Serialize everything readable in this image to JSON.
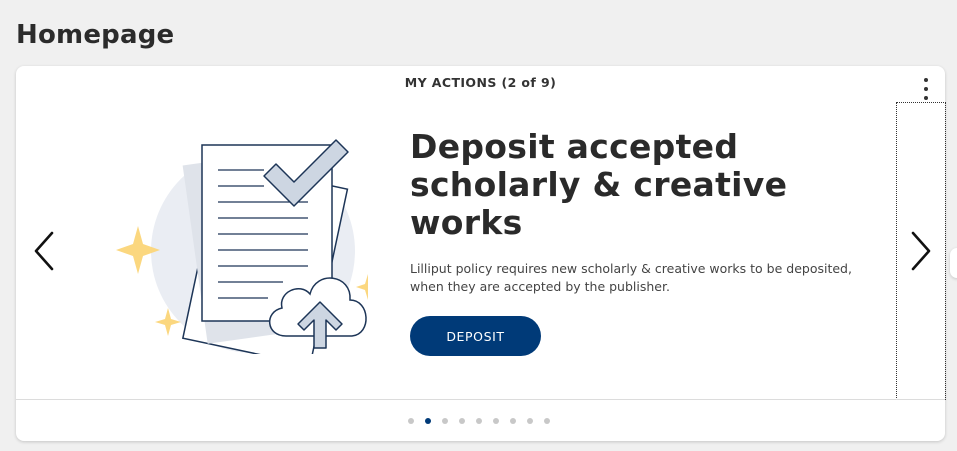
{
  "page": {
    "title": "Homepage"
  },
  "card": {
    "header": "MY ACTIONS (2 of 9)",
    "headline": "Deposit accepted scholarly & creative works",
    "description": "Lilliput policy requires new scholarly & creative works to be deposited, when they are accepted by the publisher.",
    "button_label": "DEPOSIT",
    "current_slide": 2,
    "total_slides": 9,
    "icons": {
      "menu": "kebab-menu-icon",
      "prev": "chevron-left-icon",
      "next": "chevron-right-icon",
      "illustration": "document-upload-illustration"
    }
  },
  "colors": {
    "accent": "#003a78",
    "background": "#f0f0f0",
    "card": "#ffffff",
    "sparkle": "#fbd77f",
    "illustration_circle": "#eaedf3"
  }
}
